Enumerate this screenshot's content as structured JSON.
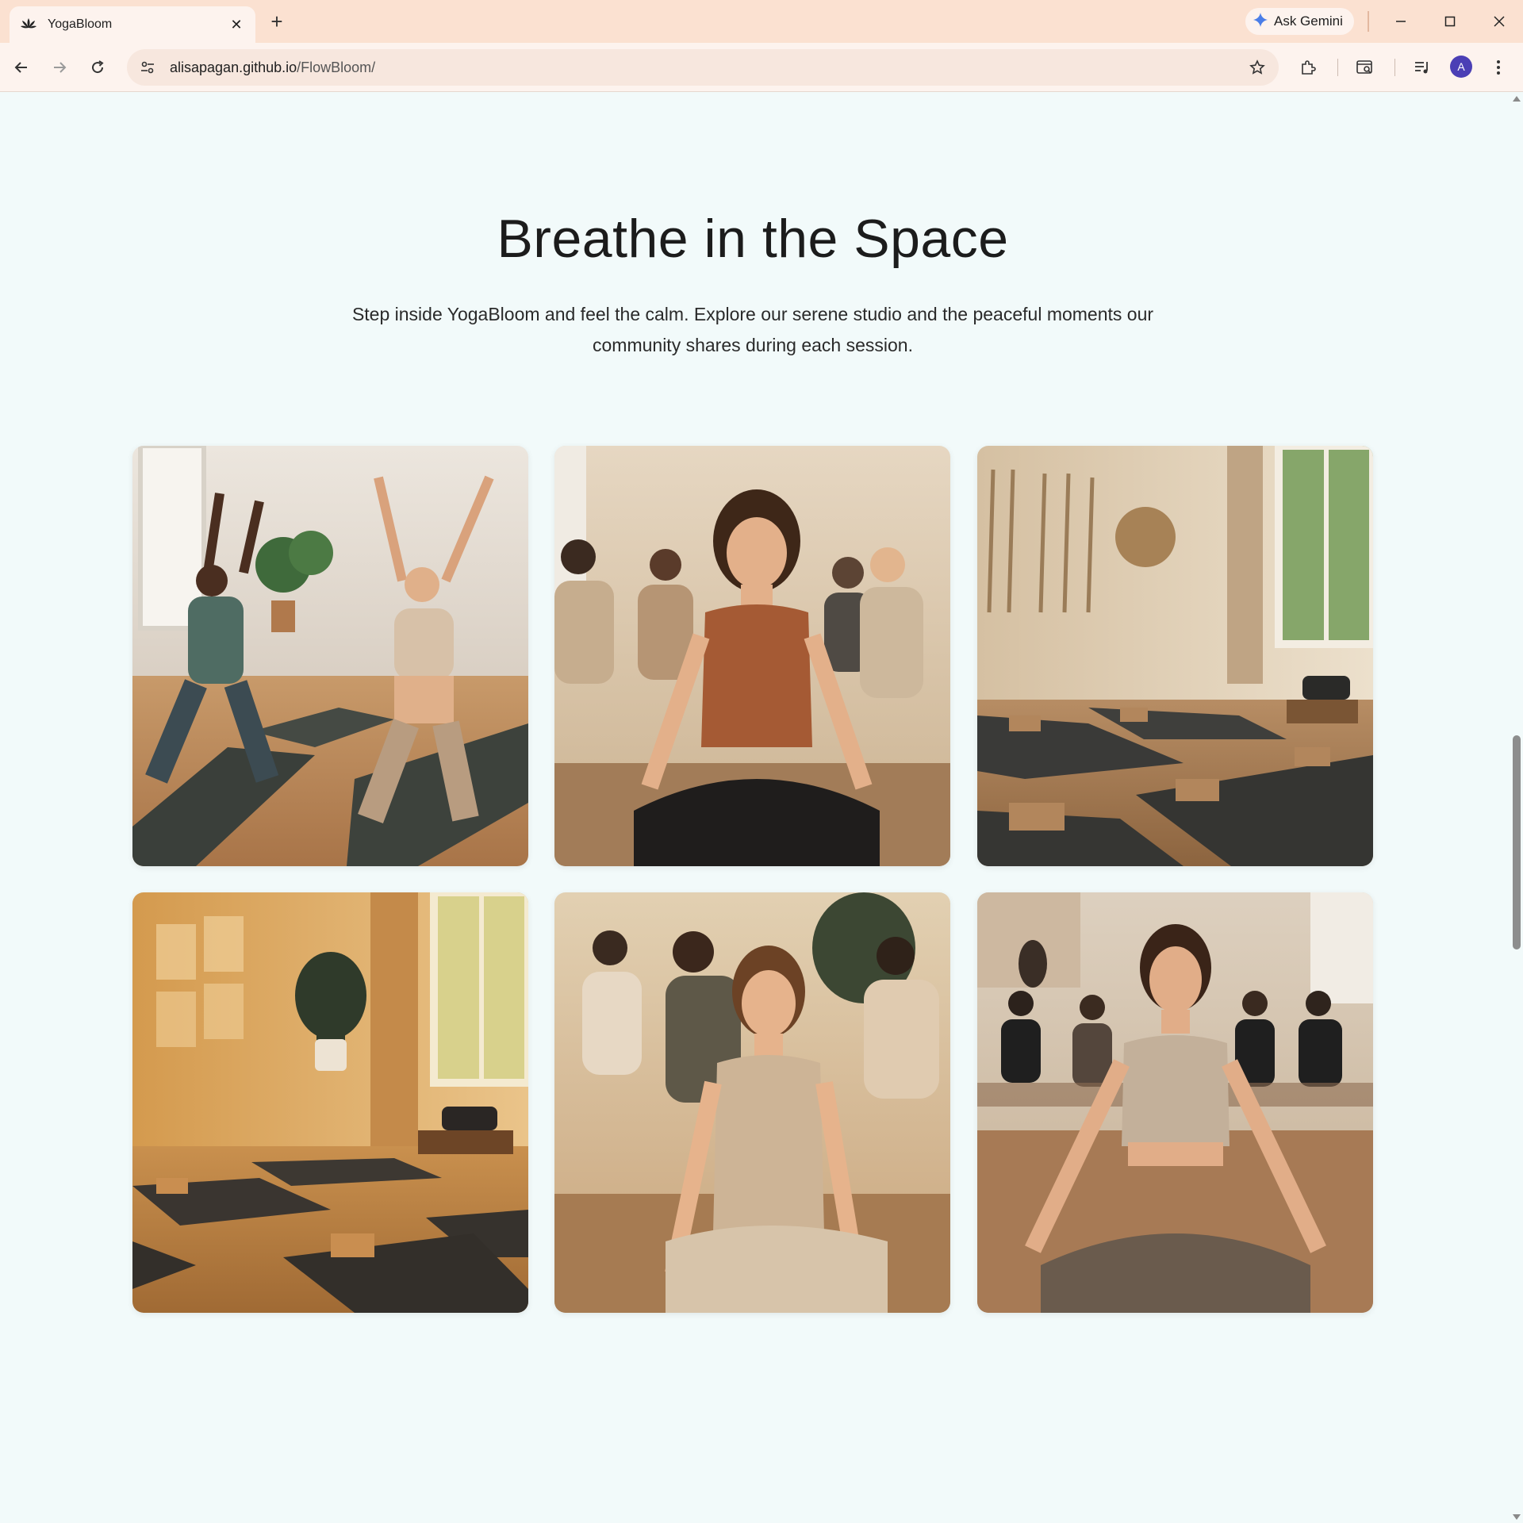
{
  "browser": {
    "tab_title": "YogaBloom",
    "new_tab_label": "+",
    "gemini_label": "Ask Gemini",
    "url_host": "alisapagan.github.io",
    "url_path": "/FlowBloom/",
    "profile_initial": "A",
    "accent_color": "#fbe1d1"
  },
  "page": {
    "title": "Breathe in the Space",
    "description": "Step inside YogaBloom and feel the calm. Explore our serene studio and the peaceful moments our community shares during each session."
  },
  "gallery": {
    "images": [
      {
        "name": "warrior-pose-class-photo"
      },
      {
        "name": "meditation-circle-photo"
      },
      {
        "name": "empty-studio-mats-photo"
      },
      {
        "name": "sunlit-studio-plant-photo"
      },
      {
        "name": "group-meditation-photo"
      },
      {
        "name": "woman-lotus-meditation-photo"
      }
    ]
  }
}
